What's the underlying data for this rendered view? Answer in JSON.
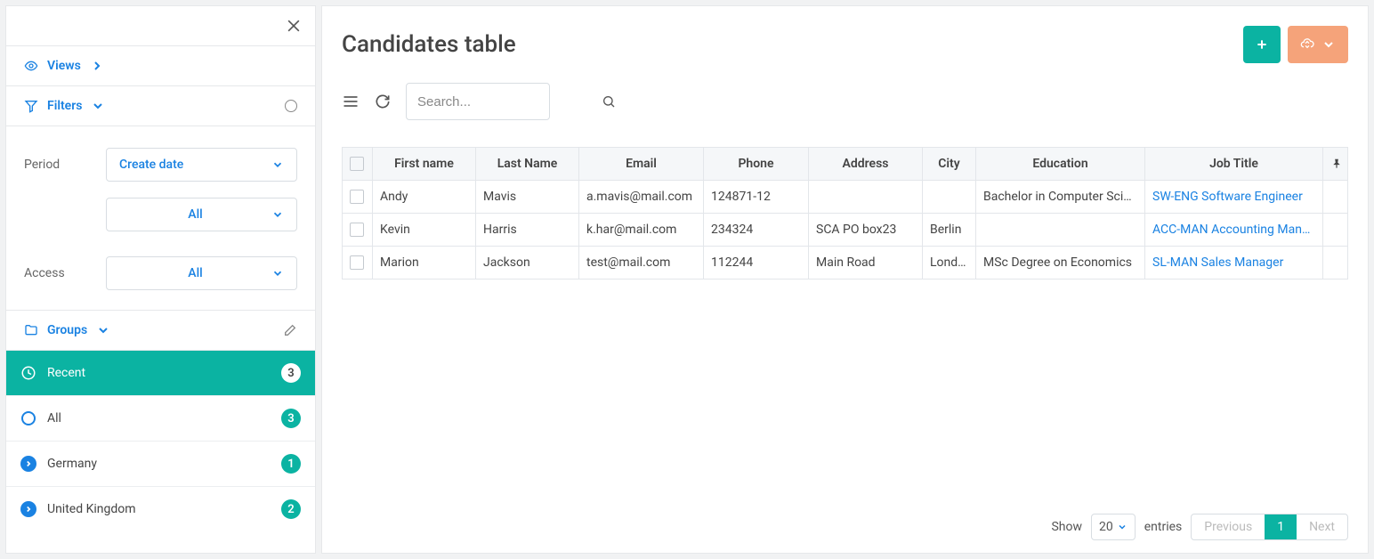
{
  "sidebar": {
    "views_label": "Views",
    "filters_label": "Filters",
    "period_label": "Period",
    "period_value": "Create date",
    "period_all": "All",
    "access_label": "Access",
    "access_value": "All",
    "groups_label": "Groups",
    "groups": [
      {
        "name": "Recent",
        "count": "3",
        "icon": "clock",
        "active": true
      },
      {
        "name": "All",
        "count": "3",
        "icon": "ring",
        "active": false
      },
      {
        "name": "Germany",
        "count": "1",
        "icon": "arrow",
        "active": false
      },
      {
        "name": "United Kingdom",
        "count": "2",
        "icon": "arrow",
        "active": false
      }
    ]
  },
  "main": {
    "title": "Candidates table",
    "search_placeholder": "Search...",
    "columns": [
      "First name",
      "Last Name",
      "Email",
      "Phone",
      "Address",
      "City",
      "Education",
      "Job Title"
    ],
    "rows": [
      {
        "first": "Andy",
        "last": "Mavis",
        "email": "a.mavis@mail.com",
        "phone": "124871-12",
        "address": "",
        "city": "",
        "education": "Bachelor in Computer Science",
        "job": "SW-ENG Software Engineer"
      },
      {
        "first": "Kevin",
        "last": "Harris",
        "email": "k.har@mail.com",
        "phone": "234324",
        "address": "SCA PO box23",
        "city": "Berlin",
        "education": "",
        "job": "ACC-MAN Accounting Manager"
      },
      {
        "first": "Marion",
        "last": "Jackson",
        "email": "test@mail.com",
        "phone": "112244",
        "address": "Main Road",
        "city": "London",
        "education": "MSc Degree on Economics",
        "job": "SL-MAN Sales Manager"
      }
    ],
    "footer": {
      "show_label": "Show",
      "page_size": "20",
      "entries_label": "entries",
      "prev": "Previous",
      "page": "1",
      "next": "Next"
    }
  }
}
